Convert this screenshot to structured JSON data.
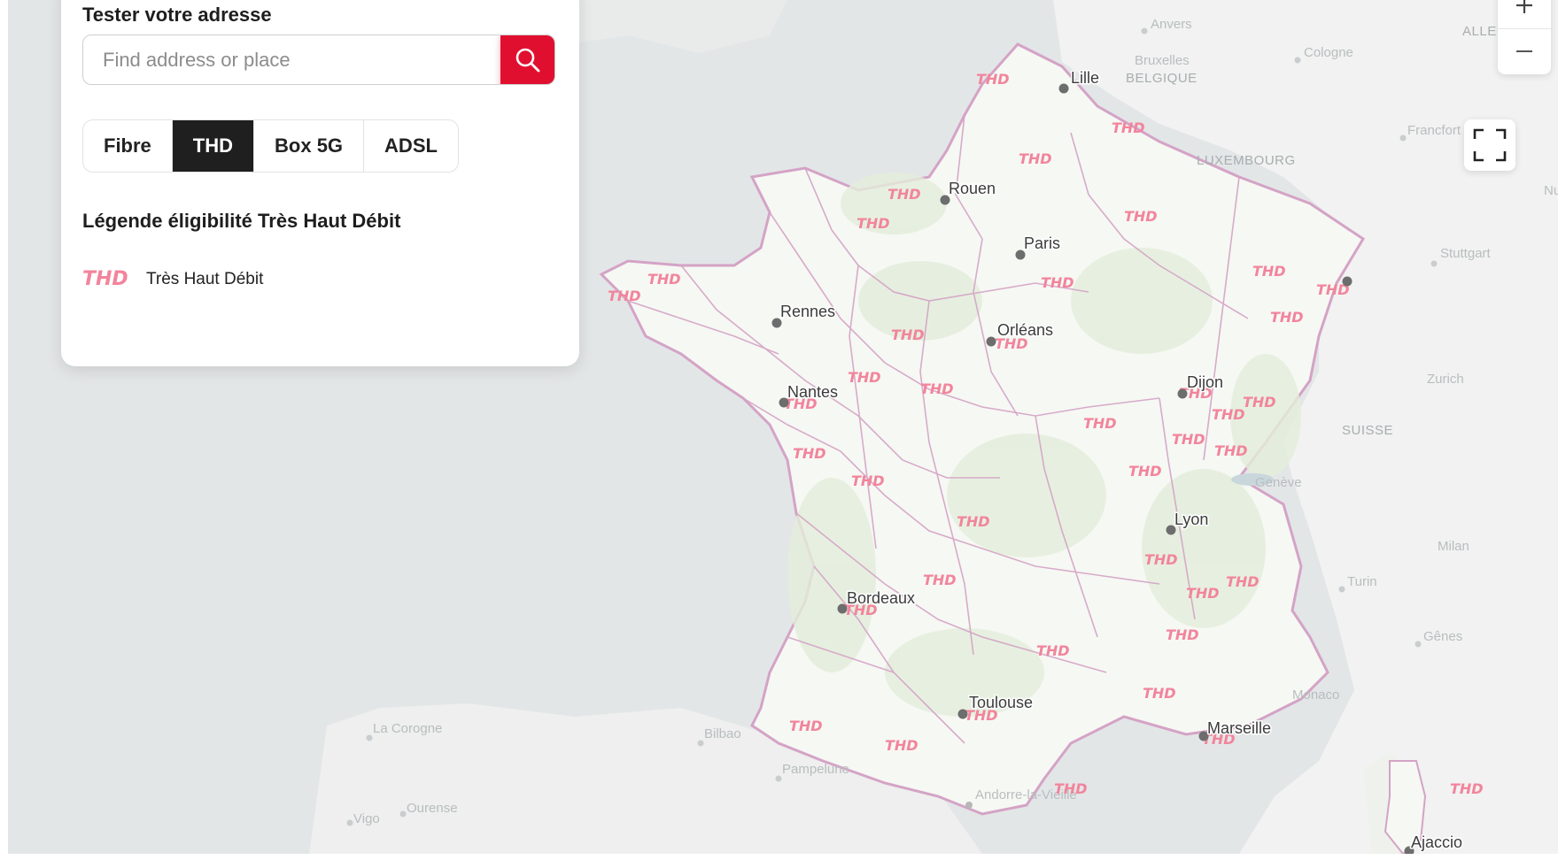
{
  "panel": {
    "title": "Tester votre adresse",
    "search": {
      "placeholder": "Find address or place",
      "value": ""
    },
    "tabs": [
      {
        "label": "Fibre",
        "active": false
      },
      {
        "label": "THD",
        "active": true
      },
      {
        "label": "Box 5G",
        "active": false
      },
      {
        "label": "ADSL",
        "active": false
      }
    ],
    "legend_title": "Légende éligibilité Très Haut Débit",
    "legend_items": [
      {
        "symbol": "THD",
        "label": "Très Haut Débit",
        "color": "#f2849c"
      }
    ]
  },
  "map": {
    "cities": [
      "Lille",
      "Rouen",
      "Paris",
      "Rennes",
      "Orléans",
      "Nantes",
      "Dijon",
      "Lyon",
      "Bordeaux",
      "Toulouse",
      "Marseille",
      "Ajaccio"
    ],
    "countries": [
      "BELGIQUE",
      "LUXEMBOURG",
      "SUISSE",
      "ALLEM"
    ],
    "foreign_places": [
      "Anvers",
      "Bruxelles",
      "Cologne",
      "Francfort",
      "Stuttgart",
      "Zurich",
      "Genève",
      "Milan",
      "Turin",
      "Gênes",
      "Monaco",
      "La Corogne",
      "Bilbao",
      "Pampelune",
      "Vigo",
      "Ourense",
      "Andorre-la-Vieille",
      "Nu"
    ],
    "marker_label": "THD",
    "colors": {
      "sea": "#e3e6e7",
      "land": "#f3f4f3",
      "france": "#f7f9f5",
      "boundary": "#d4a3c6",
      "thd": "#f2849c",
      "accent": "#e10f2f"
    }
  },
  "controls": {
    "zoom_in": "+",
    "zoom_out": "−"
  }
}
